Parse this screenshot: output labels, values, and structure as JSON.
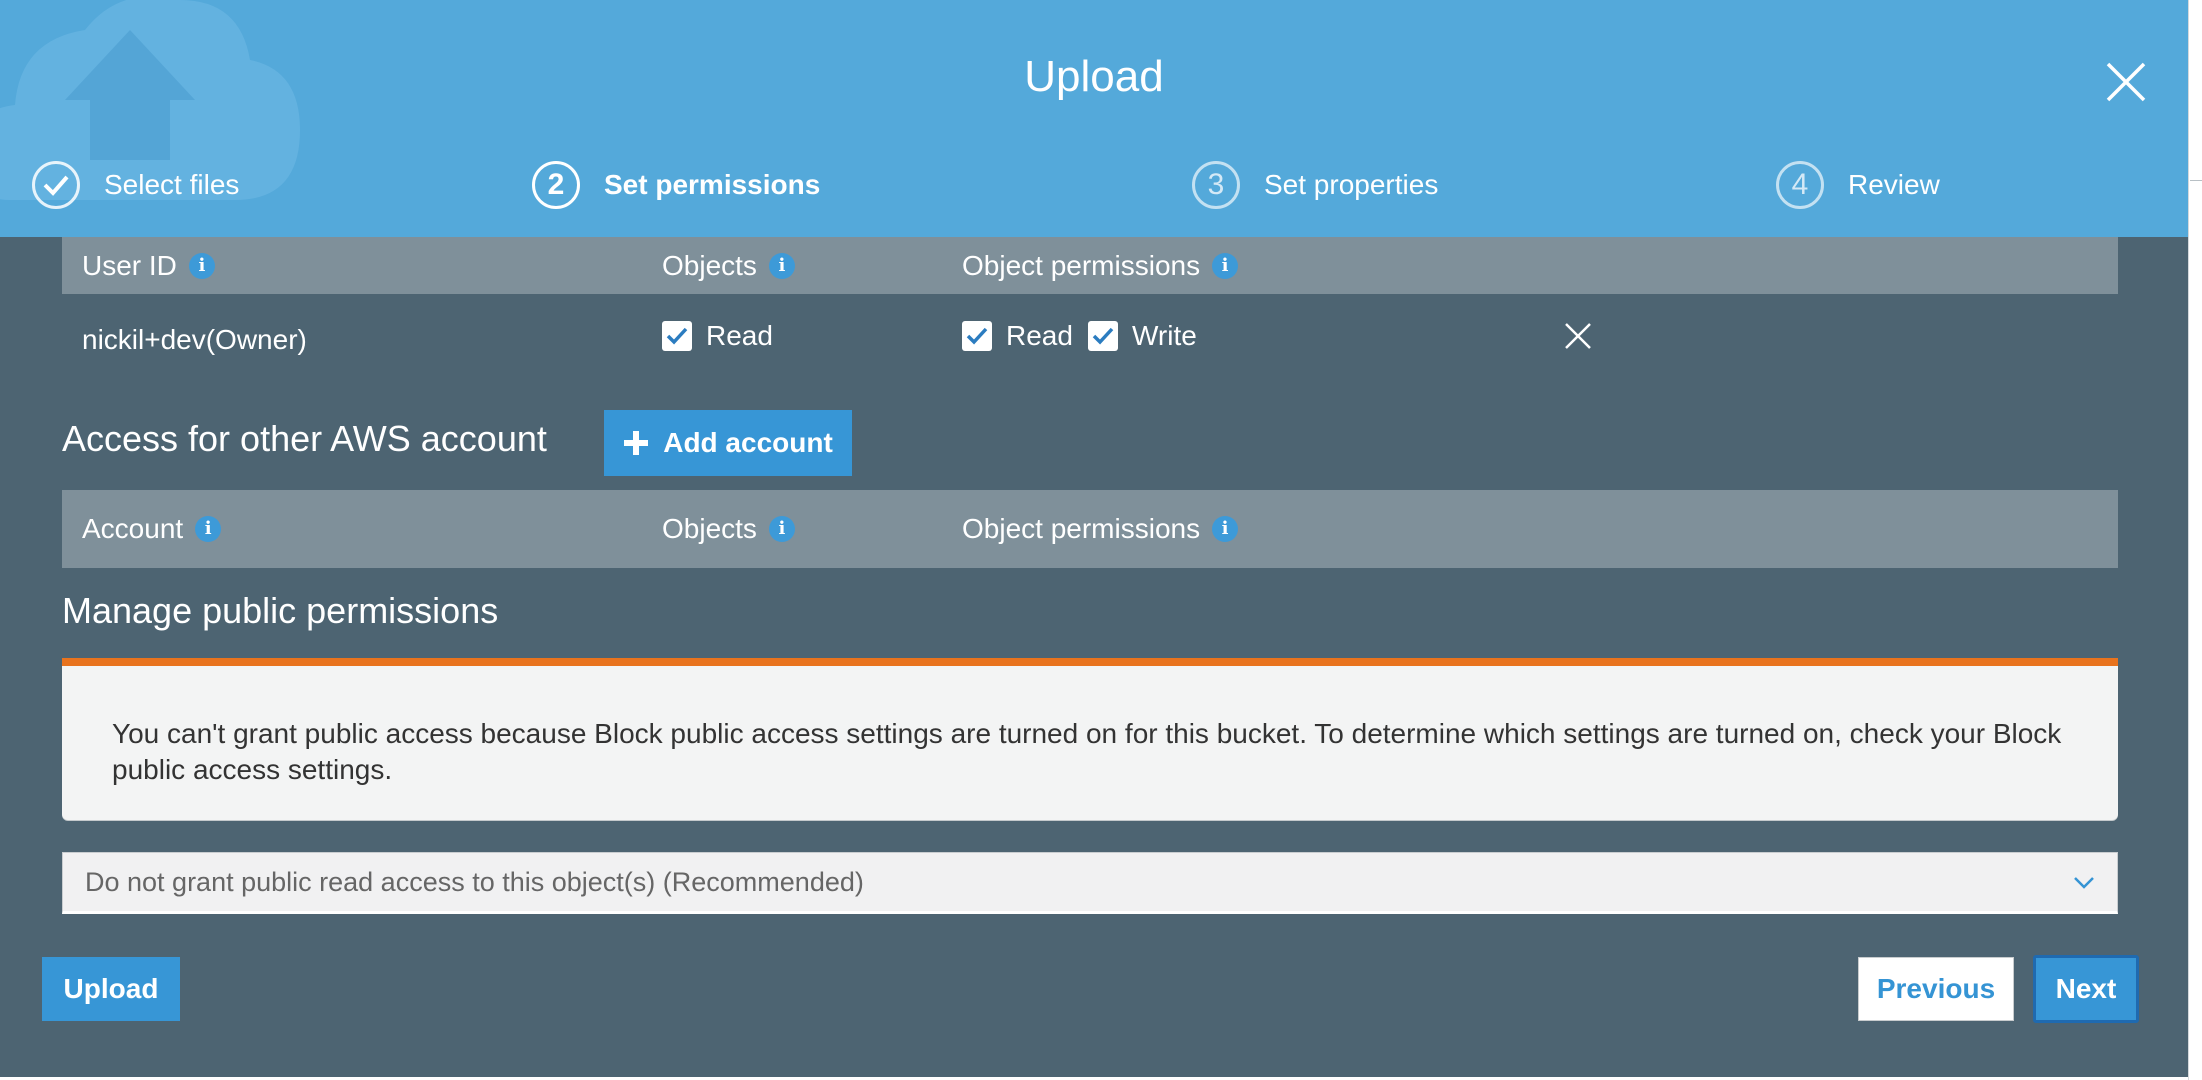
{
  "modal": {
    "title": "Upload"
  },
  "steps": [
    {
      "number": "1",
      "label": "Select files",
      "state": "done"
    },
    {
      "number": "2",
      "label": "Set permissions",
      "state": "active"
    },
    {
      "number": "3",
      "label": "Set properties",
      "state": "upcoming"
    },
    {
      "number": "4",
      "label": "Review",
      "state": "upcoming"
    }
  ],
  "owner_table": {
    "headers": {
      "user_id": "User ID",
      "objects": "Objects",
      "object_permissions": "Object permissions"
    },
    "rows": [
      {
        "user": "nickil+dev(Owner)",
        "objects_read": "Read",
        "perm_read": "Read",
        "perm_write": "Write",
        "objects_read_checked": true,
        "perm_read_checked": true,
        "perm_write_checked": true
      }
    ]
  },
  "other_accounts": {
    "title": "Access for other AWS account",
    "add_button": "Add account",
    "headers": {
      "account": "Account",
      "objects": "Objects",
      "object_permissions": "Object permissions"
    }
  },
  "public": {
    "title": "Manage public permissions",
    "alert_text": "You can't grant public access because Block public access settings are turned on for this bucket. To determine which settings are turned on, check your Block public access settings.",
    "select_value": "Do not grant public read access to this object(s) (Recommended)"
  },
  "footer": {
    "upload": "Upload",
    "previous": "Previous",
    "next": "Next"
  },
  "colors": {
    "header": "#54a9da",
    "body": "#4d6472",
    "table_header": "#7f909a",
    "accent": "#3796d6",
    "warning": "#e8731e"
  },
  "icons": {
    "close": "close-icon",
    "info": "info-icon",
    "check": "check-icon",
    "plus": "plus-icon",
    "chevron": "chevron-down-icon",
    "remove": "remove-icon"
  }
}
